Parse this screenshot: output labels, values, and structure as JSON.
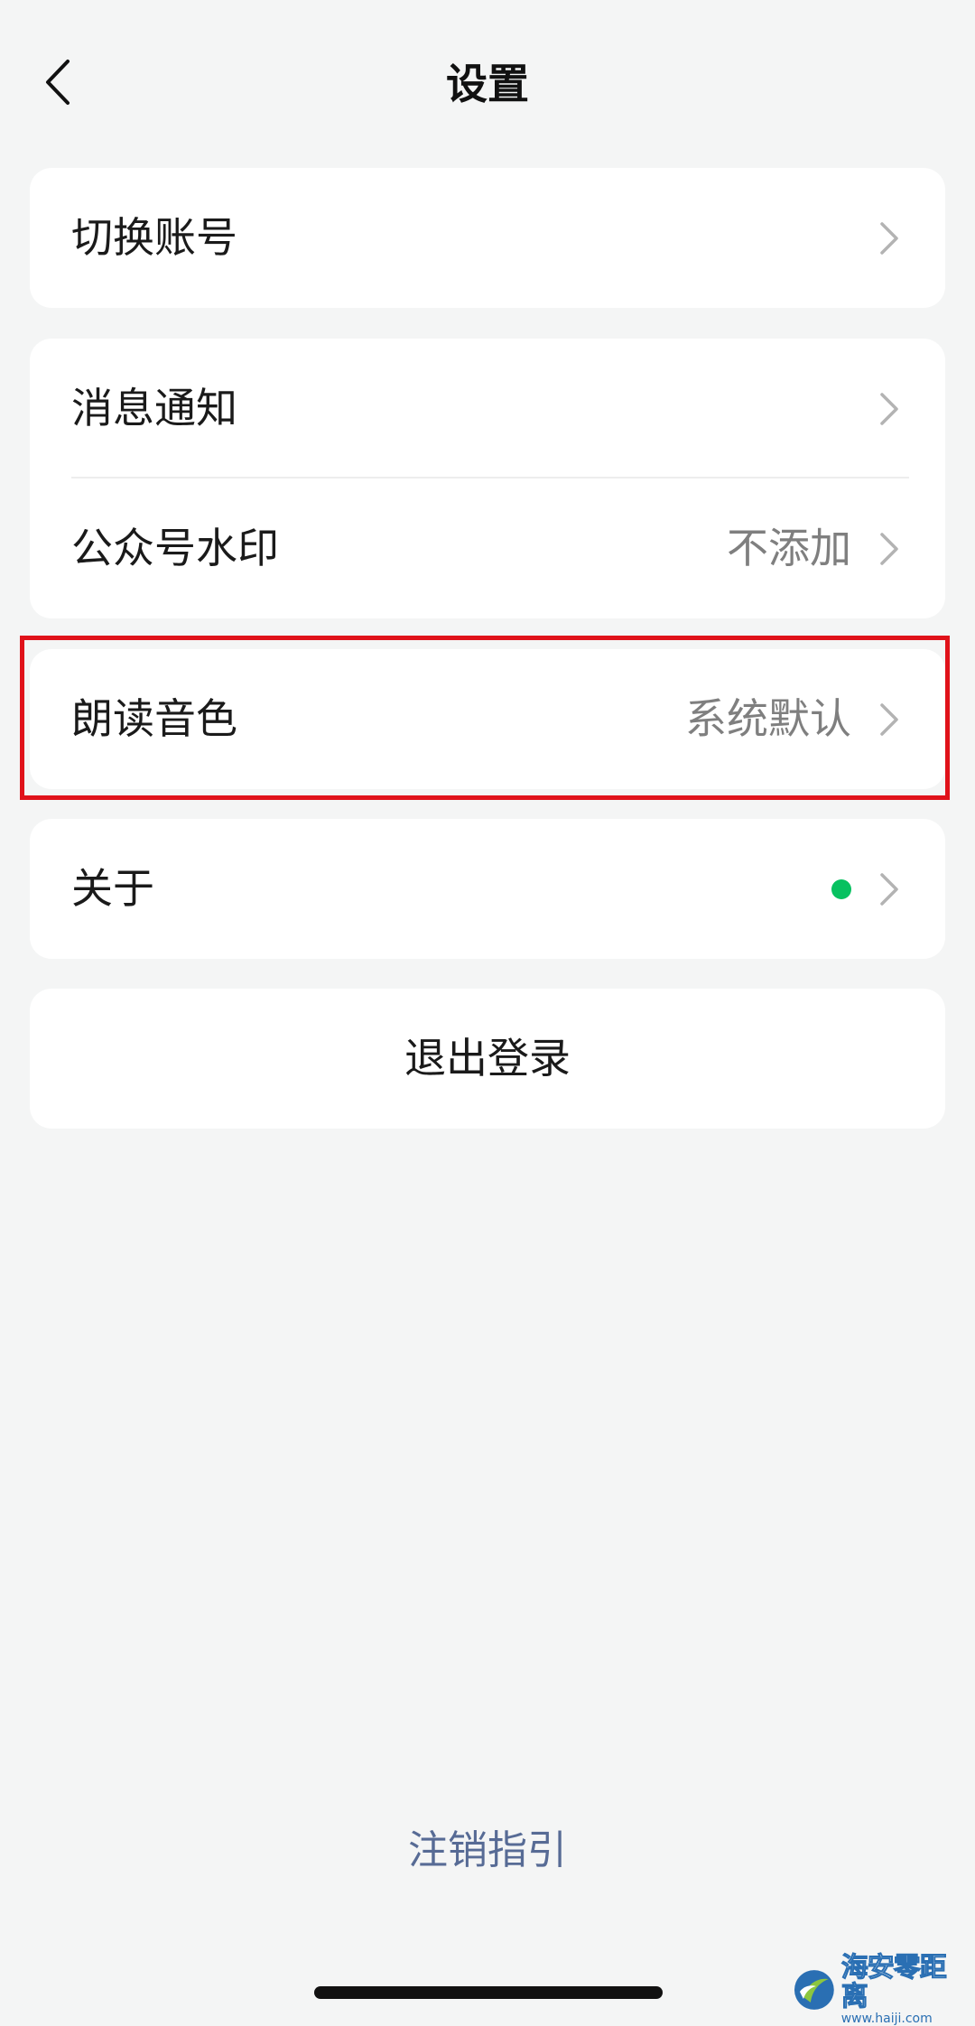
{
  "header": {
    "title": "设置"
  },
  "card_account": {
    "switch_account": "切换账号"
  },
  "card_settings": {
    "notifications": "消息通知",
    "watermark_label": "公众号水印",
    "watermark_value": "不添加"
  },
  "card_voice": {
    "voice_label": "朗读音色",
    "voice_value": "系统默认"
  },
  "card_about": {
    "about_label": "关于"
  },
  "logout": {
    "label": "退出登录"
  },
  "footer": {
    "cancel_guide": "注销指引"
  },
  "watermark_brand": {
    "name": "海安零距离",
    "url": "www.haiji.com"
  },
  "colors": {
    "background": "#f4f5f5",
    "card": "#ffffff",
    "badge_dot": "#07c160",
    "link": "#576b95",
    "highlight": "#e0121a"
  }
}
